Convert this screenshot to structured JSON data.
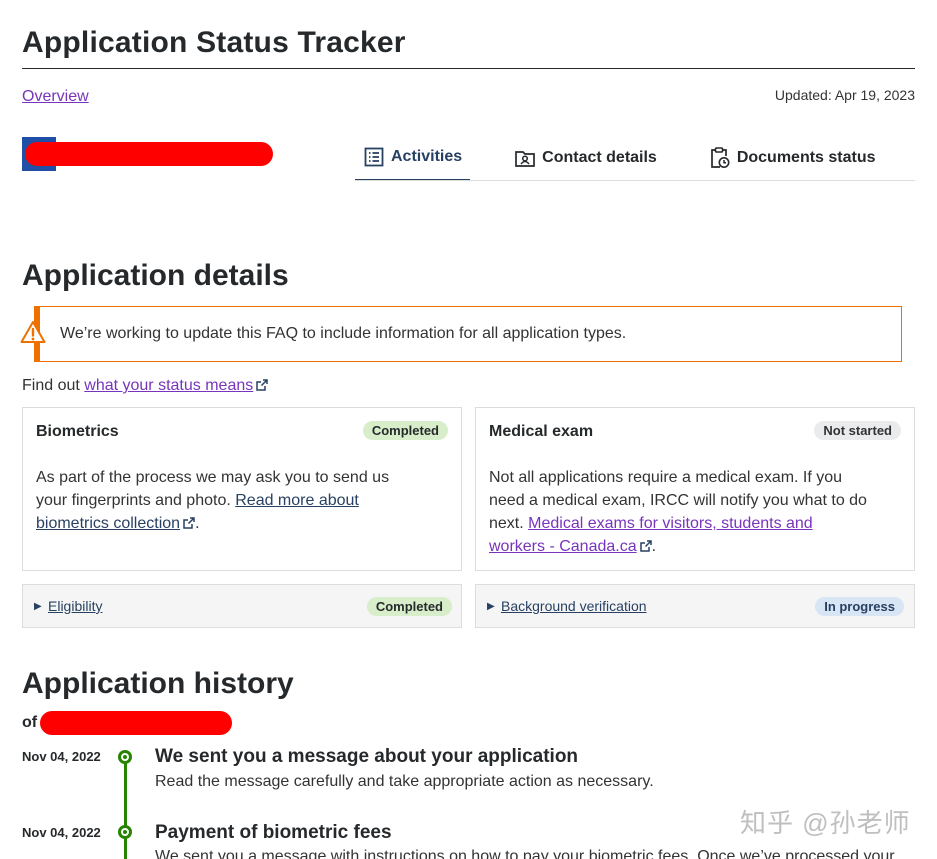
{
  "header": {
    "title": "Application Status Tracker",
    "overview_link": "Overview",
    "updated": "Updated: Apr 19, 2023"
  },
  "tabs": [
    {
      "label": "Activities",
      "icon": "list-icon",
      "active": true
    },
    {
      "label": "Contact details",
      "icon": "contact-card-icon",
      "active": false
    },
    {
      "label": "Documents status",
      "icon": "clipboard-clock-icon",
      "active": false
    }
  ],
  "details": {
    "title": "Application details",
    "alert": "We’re working to update this FAQ to include information for all application types.",
    "find_out_prefix": "Find out ",
    "find_out_link": "what your status means",
    "cards": [
      {
        "title": "Biometrics",
        "badge": "Completed",
        "body_line1": "As part of the process we may ask you to send us",
        "body_line2": "your fingerprints and photo. ",
        "link_line1": "Read more about",
        "link_line2": "biometrics collection",
        "tail": "."
      },
      {
        "title": "Medical exam",
        "badge": "Not started",
        "body_line1": "Not all applications require a medical exam. If you",
        "body_line2": "need a medical exam, IRCC will notify you what to do",
        "body_line3": "next. ",
        "link_line1": "Medical exams for visitors, students and",
        "link_line2": "workers - Canada.ca",
        "tail": "."
      }
    ],
    "rows": [
      {
        "label": "Eligibility",
        "badge": "Completed"
      },
      {
        "label": "Background verification",
        "badge": "In progress"
      }
    ]
  },
  "history": {
    "title": "Application history",
    "of_label": "of",
    "items": [
      {
        "date": "Nov 04, 2022",
        "title": "We sent you a message about your application",
        "desc": "Read the message carefully and take appropriate action as necessary."
      },
      {
        "date": "Nov 04, 2022",
        "title": "Payment of biometric fees",
        "desc": "We sent you a message with instructions on how to pay your biometric fees. Once we’ve processed your"
      }
    ]
  },
  "watermark": "知乎 @孙老师",
  "colors": {
    "accent": "#284162",
    "visited_link": "#7834bc",
    "warning": "#ee7100",
    "success": "#278400",
    "badge_completed": "#d8eeca",
    "badge_in_progress": "#d7e5f5",
    "badge_not_started": "#eaebed"
  }
}
